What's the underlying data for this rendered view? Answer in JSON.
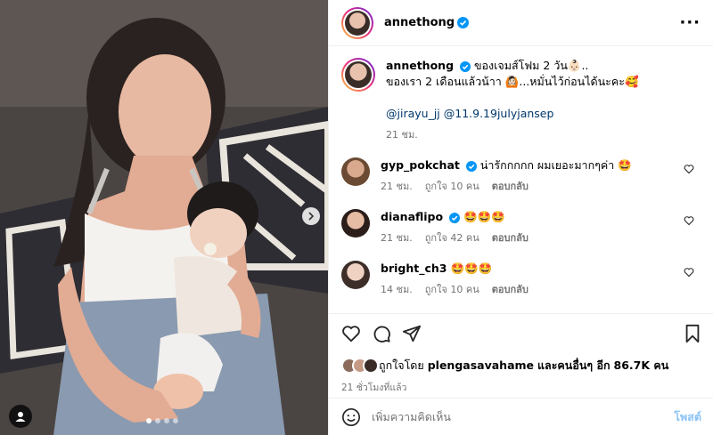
{
  "post": {
    "username": "annethong",
    "more_icon": "more-horizontal-icon"
  },
  "caption": {
    "username": "annethong",
    "line1": "ของเจมส์โฟม 2 วัน👶🏻..",
    "line2": "ของเรา 2 เดือนแล้วน้าา 🙆🏻...หมั่นไว้ก่อนได้นะคะ🥰",
    "mention1": "@jirayu_jj",
    "mention2": "@11.9.19julyjansep",
    "time": "21 ชม."
  },
  "comments": [
    {
      "username": "gyp_pokchat",
      "verified": true,
      "text": "น่ารักกกกก ผมเยอะมากๆค่า 🤩",
      "time": "21 ชม.",
      "likes": "ถูกใจ 10 คน",
      "reply": "ตอบกลับ"
    },
    {
      "username": "dianaflipo",
      "verified": true,
      "text": "🤩🤩🤩",
      "time": "21 ชม.",
      "likes": "ถูกใจ 42 คน",
      "reply": "ตอบกลับ"
    },
    {
      "username": "bright_ch3",
      "verified": false,
      "text": "🤩🤩🤩",
      "time": "14 ชม.",
      "likes": "ถูกใจ 10 คน",
      "reply": "ตอบกลับ"
    }
  ],
  "likes": {
    "prefix": "ถูกใจโดย",
    "user": "plengasavahame",
    "mid": "และคนอื่นๆ อีก",
    "count": "86.7K คน"
  },
  "timestamp": "21 ชั่วโมงที่แล้ว",
  "add_comment": {
    "placeholder": "เพิ่มความคิดเห็น",
    "post_label": "โพสต์"
  },
  "carousel": {
    "total": 4,
    "active": 1
  },
  "colors": {
    "verified": "#0095f6",
    "link": "#00376b",
    "post_disabled": "#8cc3f5"
  }
}
